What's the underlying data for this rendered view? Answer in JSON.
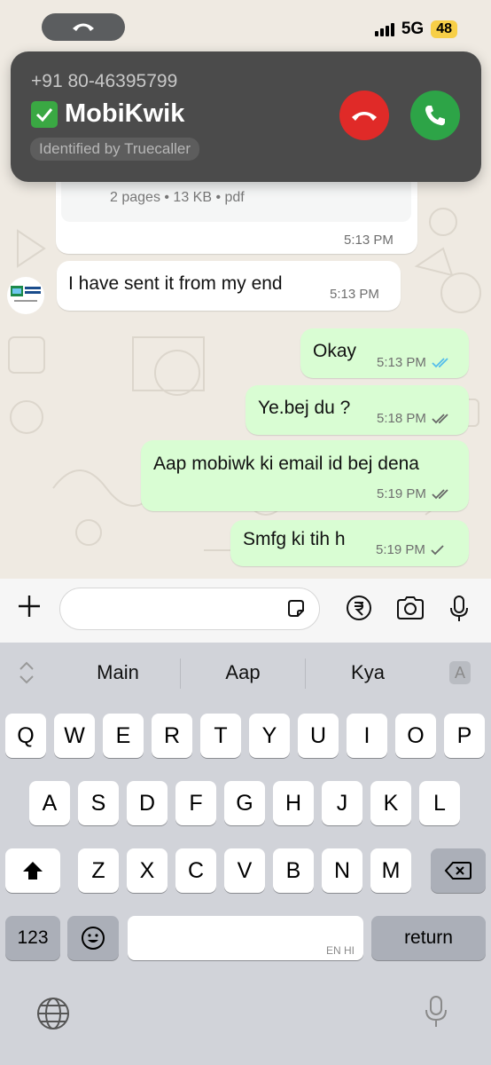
{
  "status_bar": {
    "network": "5G",
    "battery": "48"
  },
  "call": {
    "number": "+91 80-46395799",
    "name": "MobiKwik",
    "identified_by": "Identified by Truecaller",
    "decline_icon": "phone-hangup-icon",
    "accept_icon": "phone-icon"
  },
  "chat": {
    "document": {
      "meta": "2 pages • 13 KB • pdf",
      "time": "5:13 PM"
    },
    "messages": [
      {
        "direction": "in",
        "text": "I have sent it from my end",
        "time": "5:13 PM"
      },
      {
        "direction": "out",
        "text": "Okay",
        "time": "5:13 PM",
        "status": "read"
      },
      {
        "direction": "out",
        "text": "Ye.bej du ?",
        "time": "5:18 PM",
        "status": "delivered"
      },
      {
        "direction": "out",
        "text": "Aap mobiwk ki email id bej dena",
        "time": "5:19 PM",
        "status": "delivered"
      },
      {
        "direction": "out",
        "text": "Smfg ki tih h",
        "time": "5:19 PM",
        "status": "sent"
      }
    ],
    "colors": {
      "read_tick": "#53bdeb",
      "out_bubble": "#d9fdd3",
      "in_bubble": "#ffffff"
    }
  },
  "input_bar": {
    "placeholder": ""
  },
  "keyboard": {
    "suggestions": [
      "Main",
      "Aap",
      "Kya"
    ],
    "row1": [
      "Q",
      "W",
      "E",
      "R",
      "T",
      "Y",
      "U",
      "I",
      "O",
      "P"
    ],
    "row2": [
      "A",
      "S",
      "D",
      "F",
      "G",
      "H",
      "J",
      "K",
      "L"
    ],
    "row3": [
      "Z",
      "X",
      "C",
      "V",
      "B",
      "N",
      "M"
    ],
    "numbers_key": "123",
    "return_key": "return",
    "space_lang": "EN HI",
    "format_key": "A"
  }
}
